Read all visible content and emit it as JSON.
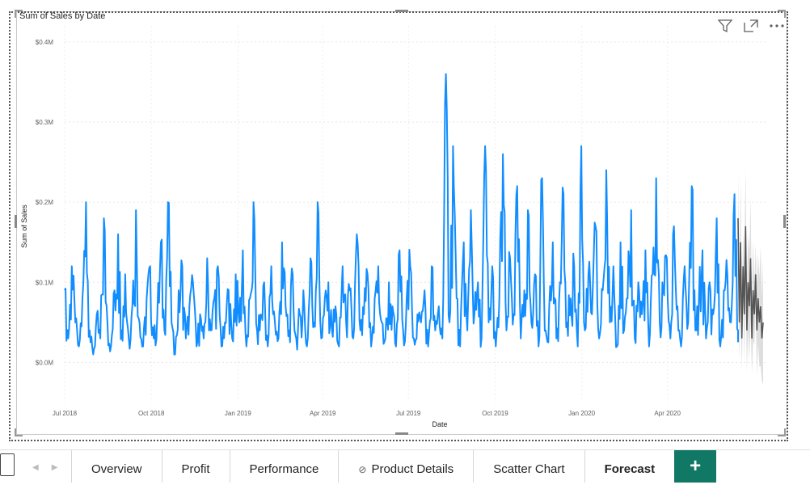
{
  "visual": {
    "title": "Sum of Sales by Date",
    "header_icons": [
      "filter-icon",
      "focus-mode-icon",
      "more-options-icon"
    ]
  },
  "chart_data": {
    "type": "line",
    "title": "Sum of Sales by Date",
    "xlabel": "Date",
    "ylabel": "Sum of Sales",
    "y_ticks": [
      "$0.4M",
      "$0.3M",
      "$0.2M",
      "$0.1M",
      "$0.0M"
    ],
    "x_ticks": [
      "Jul 2018",
      "Oct 2018",
      "Jan 2019",
      "Apr 2019",
      "Jul 2019",
      "Oct 2019",
      "Jan 2020",
      "Apr 2020"
    ],
    "ylim": [
      -0.05,
      0.42
    ],
    "grid": true,
    "series": [
      {
        "kind": "actual",
        "color": "#118DFF",
        "x_start": "2018-07-01",
        "x_end": "2020-06-15",
        "values_millions": [
          0.09,
          0.03,
          0.12,
          0.05,
          0.02,
          0.08,
          0.2,
          0.04,
          0.01,
          0.06,
          0.03,
          0.18,
          0.05,
          0.02,
          0.09,
          0.16,
          0.04,
          0.11,
          0.03,
          0.07,
          0.19,
          0.05,
          0.02,
          0.08,
          0.12,
          0.03,
          0.06,
          0.15,
          0.04,
          0.2,
          0.05,
          0.01,
          0.09,
          0.12,
          0.03,
          0.07,
          0.1,
          0.02,
          0.06,
          0.03,
          0.13,
          0.04,
          0.08,
          0.12,
          0.02,
          0.05,
          0.09,
          0.03,
          0.11,
          0.05,
          0.14,
          0.02,
          0.08,
          0.2,
          0.04,
          0.06,
          0.1,
          0.02,
          0.12,
          0.05,
          0.03,
          0.15,
          0.07,
          0.04,
          0.11,
          0.03,
          0.06,
          0.09,
          0.02,
          0.13,
          0.05,
          0.2,
          0.03,
          0.08,
          0.1,
          0.04,
          0.07,
          0.02,
          0.12,
          0.05,
          0.09,
          0.03,
          0.16,
          0.04,
          0.06,
          0.11,
          0.02,
          0.08,
          0.12,
          0.05,
          0.03,
          0.1,
          0.07,
          0.02,
          0.14,
          0.04,
          0.08,
          0.12,
          0.03,
          0.06,
          0.05,
          0.09,
          0.02,
          0.12,
          0.04,
          0.07,
          0.03,
          0.36,
          0.05,
          0.27,
          0.08,
          0.02,
          0.15,
          0.04,
          0.19,
          0.06,
          0.1,
          0.03,
          0.27,
          0.05,
          0.12,
          0.02,
          0.08,
          0.26,
          0.04,
          0.13,
          0.06,
          0.22,
          0.03,
          0.09,
          0.19,
          0.05,
          0.11,
          0.02,
          0.23,
          0.04,
          0.07,
          0.15,
          0.03,
          0.1,
          0.21,
          0.05,
          0.08,
          0.12,
          0.02,
          0.27,
          0.04,
          0.11,
          0.06,
          0.17,
          0.03,
          0.09,
          0.24,
          0.05,
          0.12,
          0.02,
          0.15,
          0.04,
          0.08,
          0.19,
          0.03,
          0.1,
          0.06,
          0.14,
          0.02,
          0.11,
          0.23,
          0.05,
          0.09,
          0.13,
          0.03,
          0.17,
          0.07,
          0.02,
          0.12,
          0.05,
          0.22,
          0.04,
          0.08,
          0.14,
          0.03,
          0.1,
          0.06,
          0.18,
          0.02,
          0.09,
          0.11,
          0.05,
          0.21,
          0.04
        ]
      },
      {
        "kind": "forecast",
        "color": "#555555",
        "band_color": "#C8C8C8",
        "values_millions": [
          0.18,
          0.05,
          0.15,
          0.03,
          0.12,
          0.06,
          0.17,
          0.04,
          0.1,
          0.07,
          0.13,
          0.03,
          0.09,
          0.06,
          0.11,
          0.04,
          0.08,
          0.05,
          0.07,
          0.03,
          0.05
        ],
        "band_half_width_millions": 0.06
      }
    ]
  },
  "tabbar": {
    "tabs": [
      {
        "label": "Overview",
        "active": false,
        "hidden": false
      },
      {
        "label": "Profit",
        "active": false,
        "hidden": false
      },
      {
        "label": "Performance",
        "active": false,
        "hidden": false
      },
      {
        "label": "Product Details",
        "active": false,
        "hidden": true
      },
      {
        "label": "Scatter Chart",
        "active": false,
        "hidden": false
      },
      {
        "label": "Forecast",
        "active": true,
        "hidden": false
      }
    ],
    "add_label": "+"
  }
}
